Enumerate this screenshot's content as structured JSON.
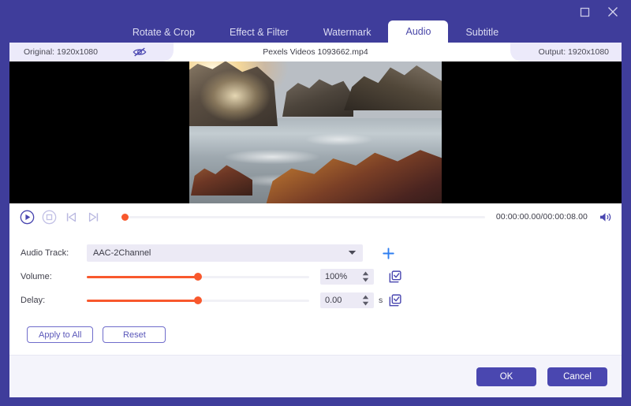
{
  "titlebar": {
    "maximize_icon": "maximize-icon",
    "close_icon": "close-icon"
  },
  "tabs": [
    {
      "label": "Rotate & Crop",
      "active": false
    },
    {
      "label": "Effect & Filter",
      "active": false
    },
    {
      "label": "Watermark",
      "active": false
    },
    {
      "label": "Audio",
      "active": true
    },
    {
      "label": "Subtitle",
      "active": false
    }
  ],
  "infobar": {
    "original_label": "Original: 1920x1080",
    "eye_icon": "eye-slash-icon",
    "file_name": "Pexels Videos 1093662.mp4",
    "output_label": "Output: 1920x1080"
  },
  "player": {
    "play_icon": "play-circle-icon",
    "stop_icon": "stop-circle-icon",
    "prev_icon": "skip-previous-icon",
    "next_icon": "skip-next-icon",
    "timeline_position_pct": 0,
    "timecode": "00:00:00.00/00:00:08.00",
    "volume_icon": "speaker-icon"
  },
  "form": {
    "audio_track": {
      "label": "Audio Track:",
      "value": "AAC-2Channel",
      "caret_icon": "chevron-down-icon",
      "add_icon": "plus-icon"
    },
    "volume": {
      "label": "Volume:",
      "value": "100%",
      "slider_pct": 50,
      "reset_icon": "checkbox-check-icon"
    },
    "delay": {
      "label": "Delay:",
      "value": "0.00",
      "unit": "s",
      "slider_pct": 50,
      "reset_icon": "checkbox-check-icon"
    },
    "apply_to_all_label": "Apply to All",
    "reset_label": "Reset"
  },
  "footer": {
    "ok_label": "OK",
    "cancel_label": "Cancel"
  },
  "colors": {
    "brand_purple": "#3f3d9b",
    "accent_button": "#4a47b0",
    "slider_orange": "#f8582d",
    "tab_active_text": "#4a47a8",
    "field_bg": "#eceaf5"
  }
}
